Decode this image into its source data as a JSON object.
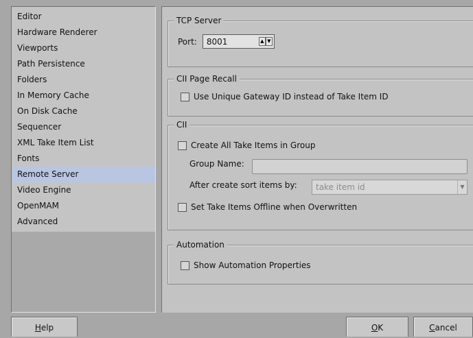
{
  "nav": {
    "items": [
      {
        "label": "Editor"
      },
      {
        "label": "Hardware Renderer"
      },
      {
        "label": "Viewports"
      },
      {
        "label": "Path Persistence"
      },
      {
        "label": "Folders"
      },
      {
        "label": "In Memory Cache"
      },
      {
        "label": "On Disk Cache"
      },
      {
        "label": "Sequencer"
      },
      {
        "label": "XML Take Item List"
      },
      {
        "label": "Fonts"
      },
      {
        "label": "Remote Server"
      },
      {
        "label": "Video Engine"
      },
      {
        "label": "OpenMAM"
      },
      {
        "label": "Advanced"
      }
    ],
    "selected": "Remote Server"
  },
  "tcp": {
    "title": "TCP Server",
    "port_label": "Port:",
    "port_value": "8001"
  },
  "cii_page_recall": {
    "title": "CII Page Recall",
    "unique_gateway_label": "Use Unique Gateway ID instead of Take Item ID",
    "unique_gateway_checked": false
  },
  "cii": {
    "title": "CII",
    "create_all_label": "Create All Take Items in Group",
    "create_all_checked": false,
    "group_name_label": "Group Name:",
    "group_name_value": "",
    "sort_label": "After create sort items by:",
    "sort_value": "take item id",
    "offline_label": "Set Take Items Offline when Overwritten",
    "offline_checked": false
  },
  "automation": {
    "title": "Automation",
    "show_props_label": "Show Automation Properties",
    "show_props_checked": false
  },
  "buttons": {
    "help_h": "H",
    "help_rest": "elp",
    "ok_o": "O",
    "ok_rest": "K",
    "cancel_c": "C",
    "cancel_rest": "ancel"
  }
}
